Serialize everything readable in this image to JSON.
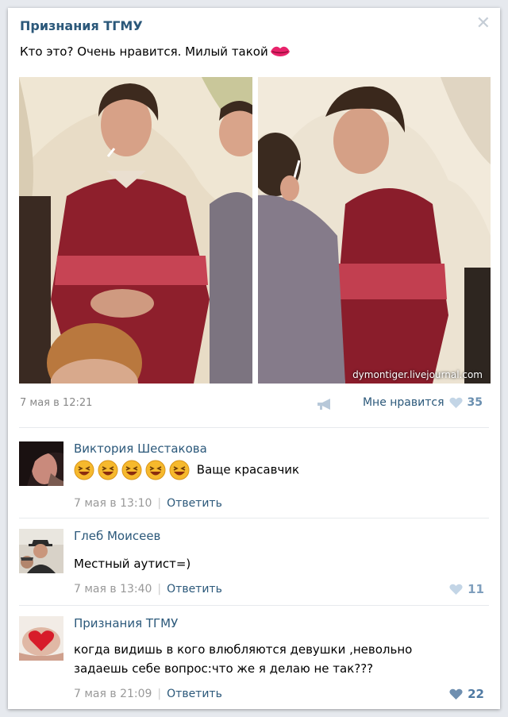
{
  "post": {
    "author": "Признания ТГМУ",
    "text": "Кто это? Очень нравится. Милый такой",
    "watermark": "dymontiger.livejournal.com",
    "date": "7 мая в 12:21",
    "like_label": "Мне нравится",
    "like_count": "35"
  },
  "comments": [
    {
      "author": "Виктория Шестакова",
      "text": "Ваще красавчик",
      "date": "7 мая в 13:10",
      "reply": "Ответить",
      "likes": ""
    },
    {
      "author": "Глеб Моисеев",
      "text": "Местный аутист=)",
      "date": "7 мая в 13:40",
      "reply": "Ответить",
      "likes": "11"
    },
    {
      "author": "Признания ТГМУ",
      "text_line1": "когда видишь в кого влюбляются девушки ,невольно",
      "text_line2": "задаешь себе вопрос:что же я делаю не так???",
      "date": "7 мая в 21:09",
      "reply": "Ответить",
      "likes": "22"
    }
  ],
  "colors": {
    "accent": "#2b587a",
    "like_heart": "#c3d5e6",
    "like_heart_active": "#6f8fb0"
  },
  "icons": {
    "close": "close-icon",
    "share": "megaphone-icon",
    "like": "heart-icon",
    "platform": "apple-icon"
  }
}
